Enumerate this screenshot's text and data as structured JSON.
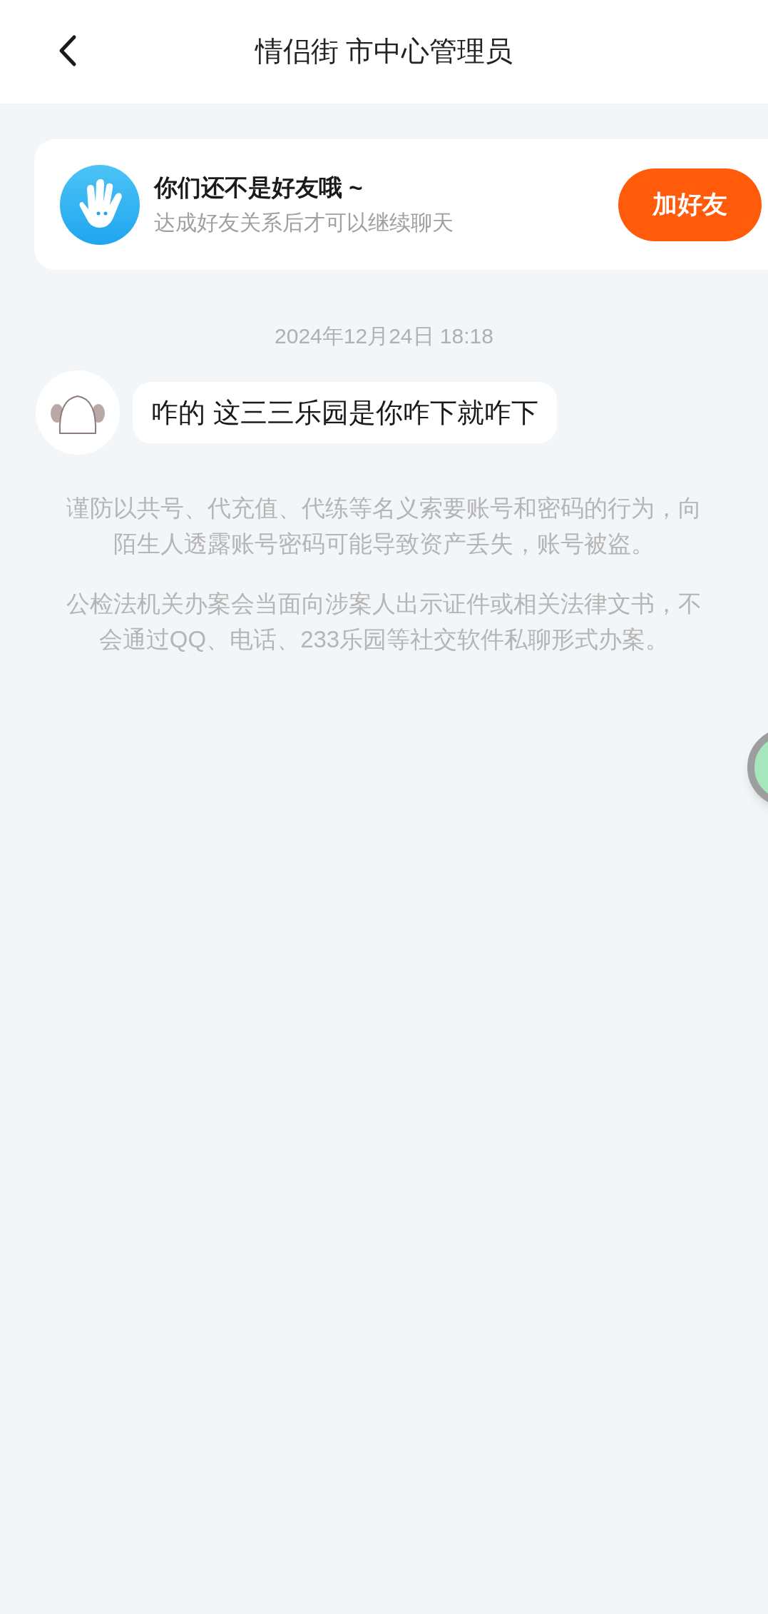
{
  "header": {
    "title": "情侣街 市中心管理员"
  },
  "friend_banner": {
    "title": "你们还不是好友哦 ~",
    "subtitle": "达成好友关系后才可以继续聊天",
    "button": "加好友"
  },
  "messages": [
    {
      "kind": "timestamp",
      "text": "2024年12月24日 18:18"
    },
    {
      "kind": "incoming",
      "text": "咋的 这三三乐园是你咋下就咋下"
    }
  ],
  "notices": [
    "谨防以共号、代充值、代练等名义索要账号和密码的行为，向陌生人透露账号密码可能导致资产丢失，账号被盗。",
    "公检法机关办案会当面向涉案人出示证件或相关法律文书，不会通过QQ、电话、233乐园等社交软件私聊形式办案。"
  ]
}
